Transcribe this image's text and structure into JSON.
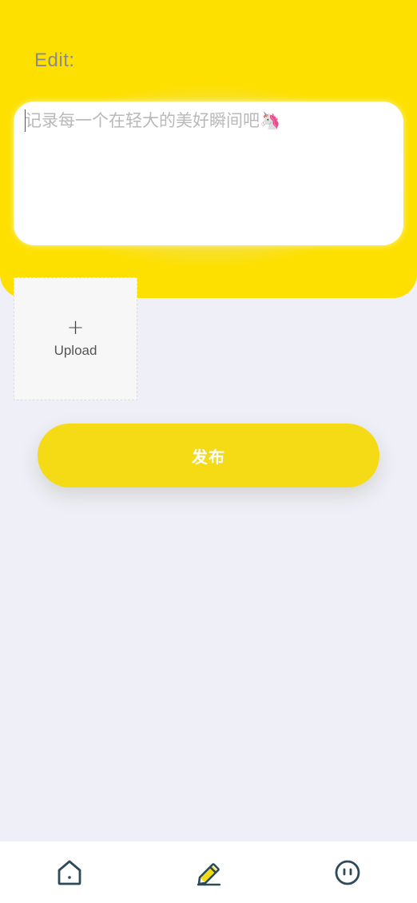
{
  "header": {
    "title": "Edit:"
  },
  "editor": {
    "placeholder": "记录每一个在轻大的美好瞬间吧🦄"
  },
  "upload": {
    "plus": "+",
    "label": "Upload"
  },
  "actions": {
    "publish_label": "发布"
  },
  "tabbar": {
    "items": [
      {
        "icon": "home-icon"
      },
      {
        "icon": "pencil-icon"
      },
      {
        "icon": "face-icon"
      }
    ]
  },
  "colors": {
    "accent": "#fde000",
    "button": "#f5da16",
    "background": "#eeeff7",
    "icon_stroke": "#2d4a5a"
  }
}
